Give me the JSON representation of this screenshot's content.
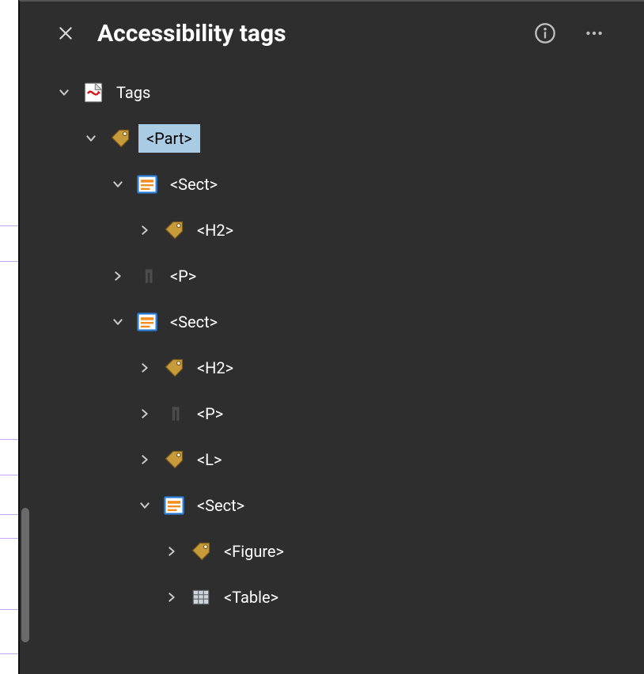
{
  "panel": {
    "title": "Accessibility tags"
  },
  "icons": {
    "close": "close-icon",
    "info": "info-icon",
    "more": "more-icon",
    "chevronDown": "chevron-down-icon",
    "chevronRight": "chevron-right-icon"
  },
  "tree": {
    "root": {
      "label": "Tags",
      "iconType": "pdf",
      "expanded": true
    },
    "nodes": [
      {
        "id": "n0",
        "depth": 0,
        "label": "Tags",
        "iconType": "pdf",
        "expanded": true,
        "hasChildren": true,
        "selected": false
      },
      {
        "id": "n1",
        "depth": 1,
        "label": "<Part>",
        "iconType": "tag",
        "expanded": true,
        "hasChildren": true,
        "selected": true
      },
      {
        "id": "n2",
        "depth": 2,
        "label": "<Sect>",
        "iconType": "sect",
        "expanded": true,
        "hasChildren": true,
        "selected": false
      },
      {
        "id": "n3",
        "depth": 3,
        "label": "<H2>",
        "iconType": "tag",
        "expanded": false,
        "hasChildren": true,
        "selected": false
      },
      {
        "id": "n4",
        "depth": 2,
        "label": "<P>",
        "iconType": "para",
        "expanded": false,
        "hasChildren": true,
        "selected": false
      },
      {
        "id": "n5",
        "depth": 2,
        "label": "<Sect>",
        "iconType": "sect",
        "expanded": true,
        "hasChildren": true,
        "selected": false
      },
      {
        "id": "n6",
        "depth": 3,
        "label": "<H2>",
        "iconType": "tag",
        "expanded": false,
        "hasChildren": true,
        "selected": false
      },
      {
        "id": "n7",
        "depth": 3,
        "label": "<P>",
        "iconType": "para",
        "expanded": false,
        "hasChildren": true,
        "selected": false
      },
      {
        "id": "n8",
        "depth": 3,
        "label": "<L>",
        "iconType": "tag",
        "expanded": false,
        "hasChildren": true,
        "selected": false
      },
      {
        "id": "n9",
        "depth": 3,
        "label": "<Sect>",
        "iconType": "sect",
        "expanded": true,
        "hasChildren": true,
        "selected": false
      },
      {
        "id": "n10",
        "depth": 4,
        "label": "<Figure>",
        "iconType": "tag",
        "expanded": false,
        "hasChildren": true,
        "selected": false
      },
      {
        "id": "n11",
        "depth": 4,
        "label": "<Table>",
        "iconType": "table",
        "expanded": false,
        "hasChildren": true,
        "selected": false
      }
    ]
  },
  "indentBase": 32,
  "indentStep": 34
}
